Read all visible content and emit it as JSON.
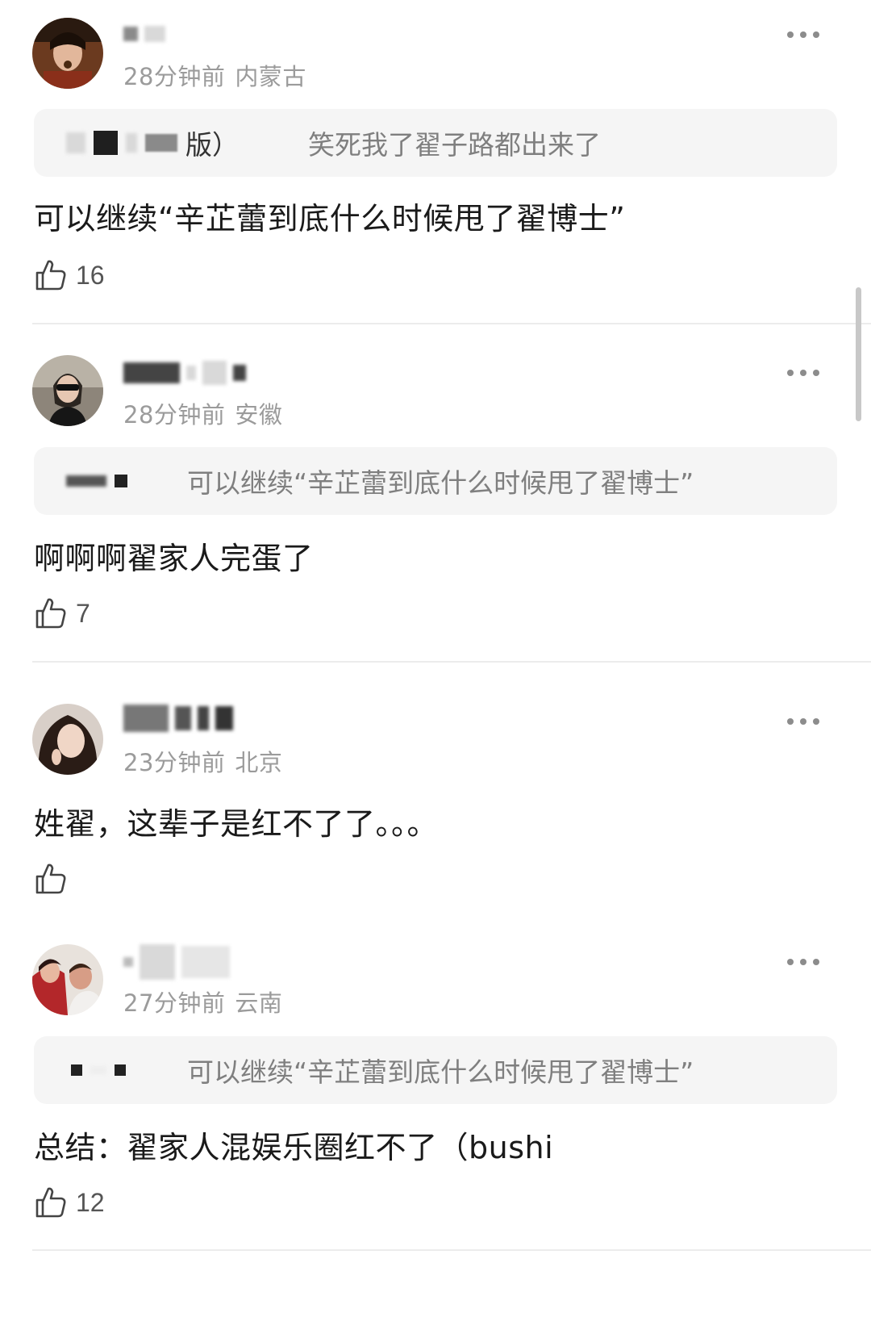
{
  "comments": [
    {
      "time": "28分钟前",
      "location": "内蒙古",
      "quote": {
        "author_suffix": "版）",
        "text": "笑死我了翟子路都出来了"
      },
      "text": "可以继续“辛芷蕾到底什么时候甩了翟博士”",
      "likes": "16"
    },
    {
      "time": "28分钟前",
      "location": "安徽",
      "quote": {
        "text": "可以继续“辛芷蕾到底什么时候甩了翟博士”"
      },
      "text": "啊啊啊翟家人完蛋了",
      "likes": "7"
    },
    {
      "time": "23分钟前",
      "location": "北京",
      "text": "姓翟，这辈子是红不了了。。。",
      "likes": ""
    },
    {
      "time": "27分钟前",
      "location": "云南",
      "quote": {
        "text": "可以继续“辛芷蕾到底什么时候甩了翟博士”"
      },
      "text": "总结：翟家人混娱乐圈红不了（bushi",
      "likes": "12"
    }
  ],
  "icons": {
    "like": "thumbs-up-icon",
    "more": "more-dots-icon",
    "avatar": "avatar-image"
  },
  "colors": {
    "meta": "#9b9b9b",
    "quote_bg": "#f5f5f5",
    "quote_text": "#7f7f7f",
    "divider": "#ececec"
  }
}
